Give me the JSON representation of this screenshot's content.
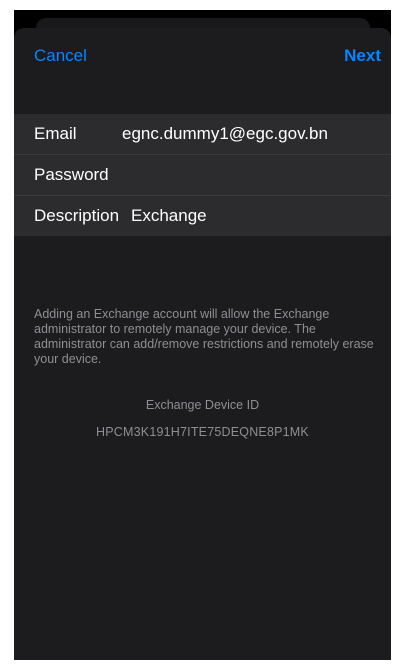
{
  "nav": {
    "cancel_label": "Cancel",
    "next_label": "Next"
  },
  "form": {
    "email": {
      "label": "Email",
      "value": "egnc.dummy1@egc.gov.bn"
    },
    "password": {
      "label": "Password",
      "value": ""
    },
    "description": {
      "label": "Description",
      "value": "Exchange"
    }
  },
  "footer": {
    "note": "Adding an Exchange account will allow the Exchange administrator to remotely manage your device. The administrator can add/remove restrictions and remotely erase your device.",
    "device_id_title": "Exchange Device ID",
    "device_id": "HPCM3K191H7ITE75DEQNE8P1MK"
  },
  "colors": {
    "accent": "#0a84ff",
    "sheet_bg": "#1c1c1e",
    "form_bg": "#2c2c2e",
    "secondary_text": "#8e8e93"
  }
}
